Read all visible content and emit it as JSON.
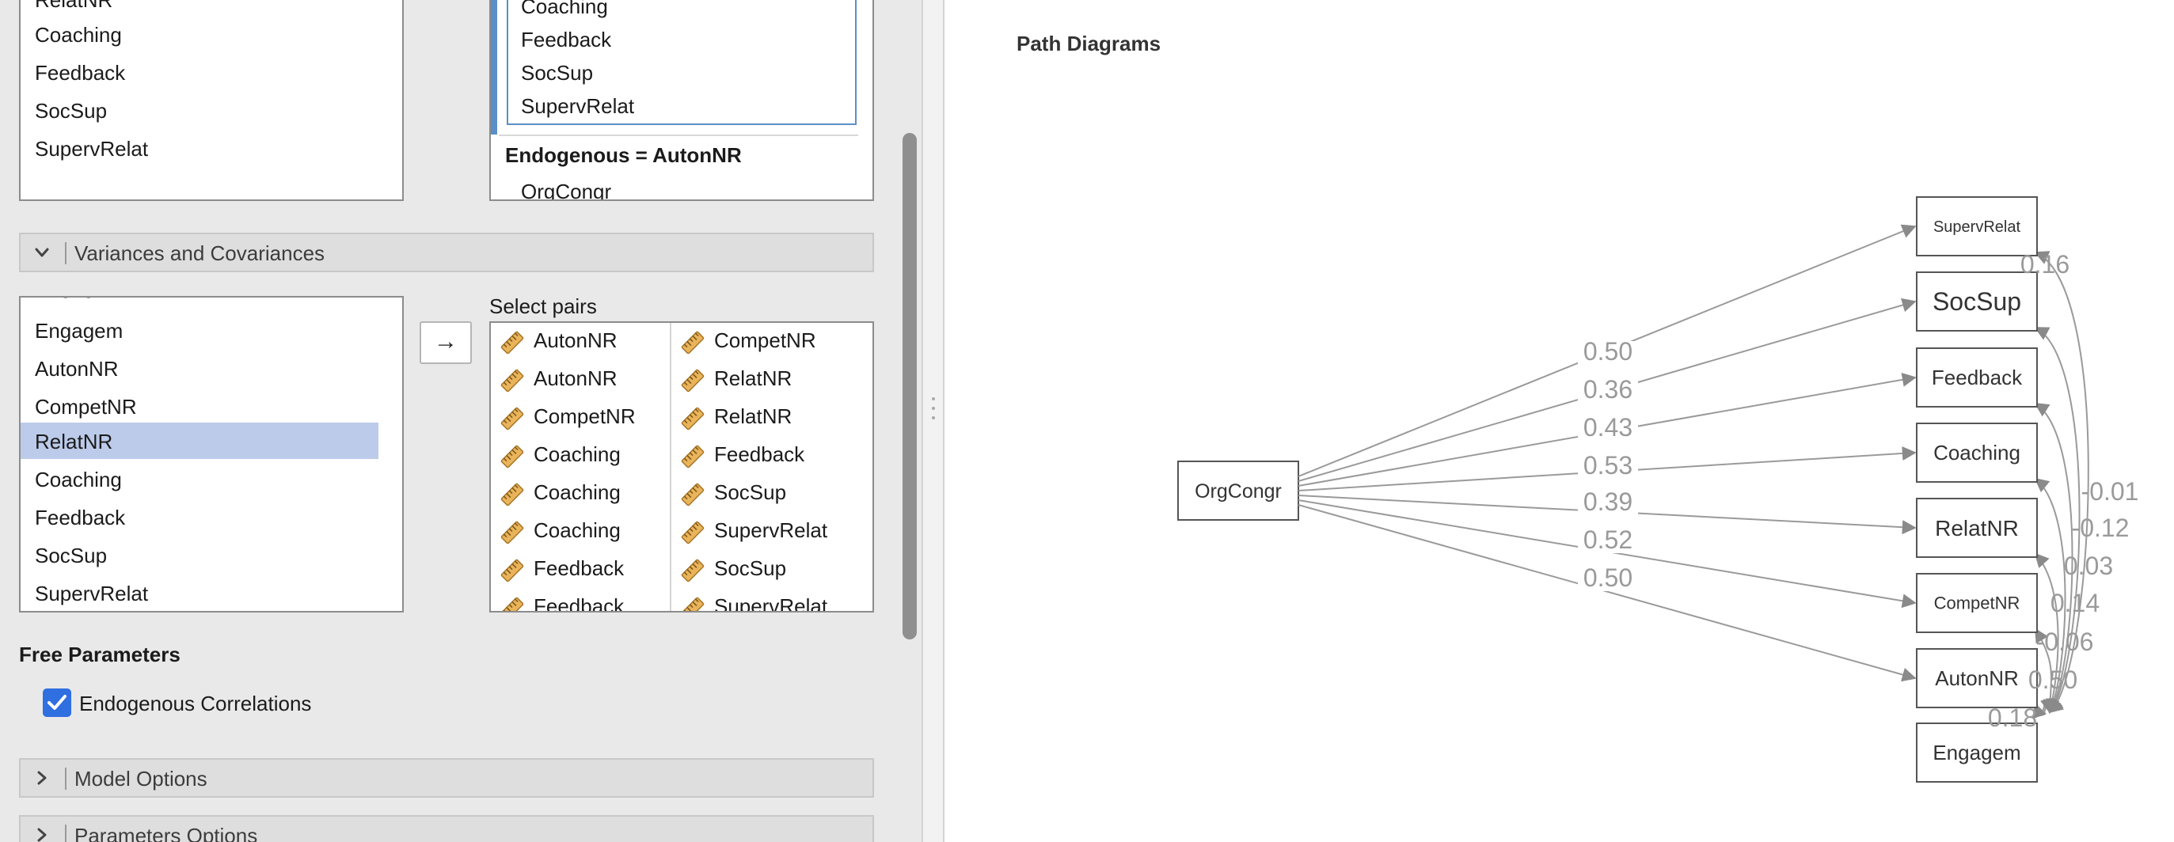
{
  "exogenous_list": {
    "items": [
      "RelatNR",
      "Coaching",
      "Feedback",
      "SocSup",
      "SupervRelat"
    ]
  },
  "selected_list": {
    "items_top": [
      "Coaching",
      "Feedback",
      "SocSup",
      "SupervRelat"
    ],
    "endogenous_heading": "Endogenous = AutonNR",
    "items_bottom": [
      "OrgCongr"
    ]
  },
  "variances_section": {
    "title": "Variances and Covariances"
  },
  "variables_list": {
    "items": [
      "Engagem",
      "AutonNR",
      "CompetNR",
      "RelatNR",
      "Coaching",
      "Feedback",
      "SocSup",
      "SupervRelat"
    ],
    "selected": "RelatNR"
  },
  "arrow_button": {
    "label": "→"
  },
  "select_pairs": {
    "label": "Select pairs",
    "pairs": [
      [
        "AutonNR",
        "CompetNR"
      ],
      [
        "AutonNR",
        "RelatNR"
      ],
      [
        "CompetNR",
        "RelatNR"
      ],
      [
        "Coaching",
        "Feedback"
      ],
      [
        "Coaching",
        "SocSup"
      ],
      [
        "Coaching",
        "SupervRelat"
      ],
      [
        "Feedback",
        "SocSup"
      ],
      [
        "Feedback",
        "SupervRelat"
      ]
    ]
  },
  "free_parameters": {
    "title": "Free Parameters",
    "endogenous_correlations": {
      "label": "Endogenous Correlations",
      "checked": true
    }
  },
  "model_options": {
    "title": "Model Options"
  },
  "parameters_options": {
    "title": "Parameters Options"
  },
  "path_diagram": {
    "title": "Path Diagrams",
    "source_node": "OrgCongr",
    "target_nodes": [
      "SupervRelat",
      "SocSup",
      "Feedback",
      "Coaching",
      "RelatNR",
      "CompetNR",
      "AutonNR",
      "Engagem"
    ],
    "path_coefficients": [
      "0.50",
      "0.36",
      "0.43",
      "0.53",
      "0.39",
      "0.52",
      "0.50"
    ],
    "covariance_labels": [
      "0.16",
      "-0.01",
      "-0.12",
      "0.03",
      "0.14",
      "-0.06",
      "0.50",
      "0.18"
    ]
  }
}
